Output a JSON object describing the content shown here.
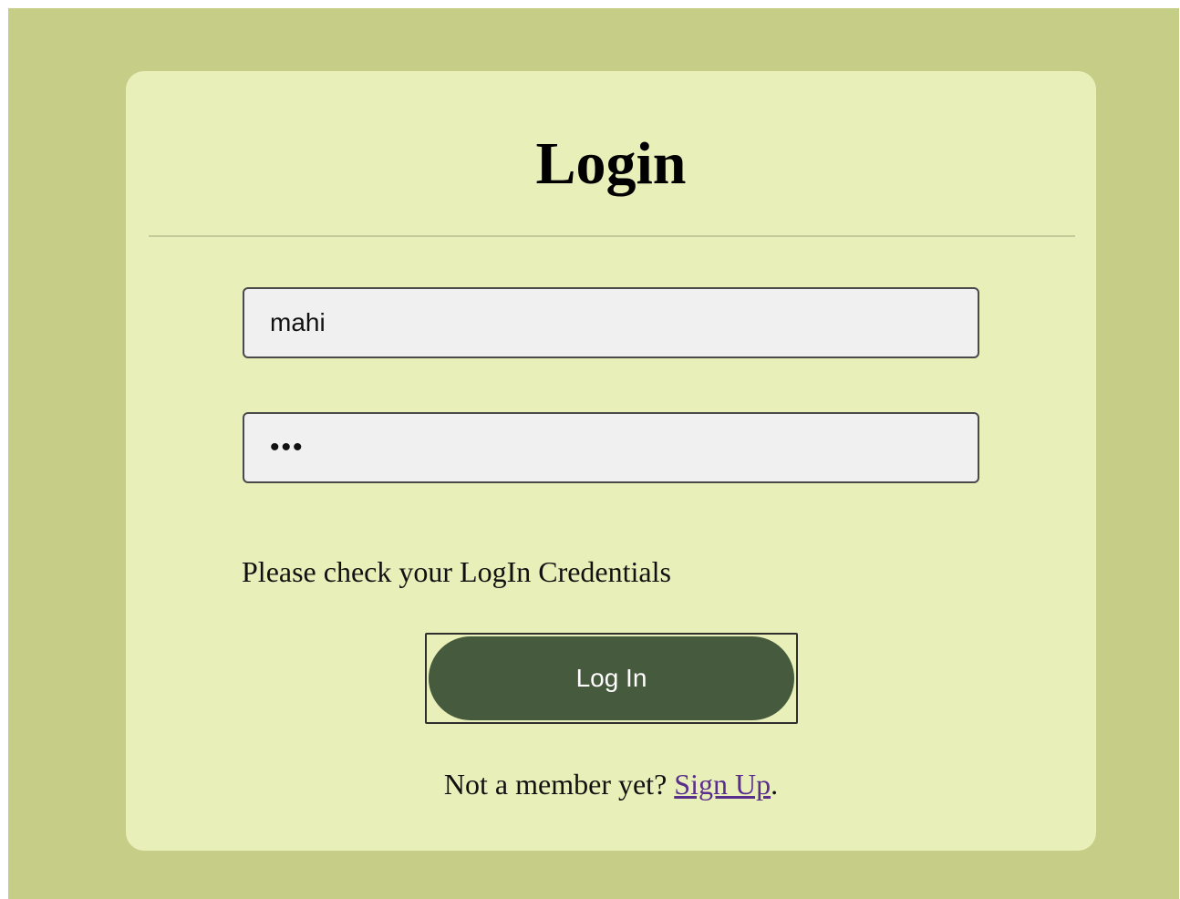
{
  "login_form": {
    "title": "Login",
    "username_value": "mahi",
    "password_value": "•••",
    "message": "Please check your LogIn Credentials",
    "submit_label": "Log In",
    "signup_prompt": "Not a member yet? ",
    "signup_link": "Sign Up",
    "signup_suffix": "."
  },
  "colors": {
    "page_background": "#c5cd86",
    "card_background": "#e9efb9",
    "button_fill": "#465a3d",
    "link": "#5a2e8c"
  }
}
